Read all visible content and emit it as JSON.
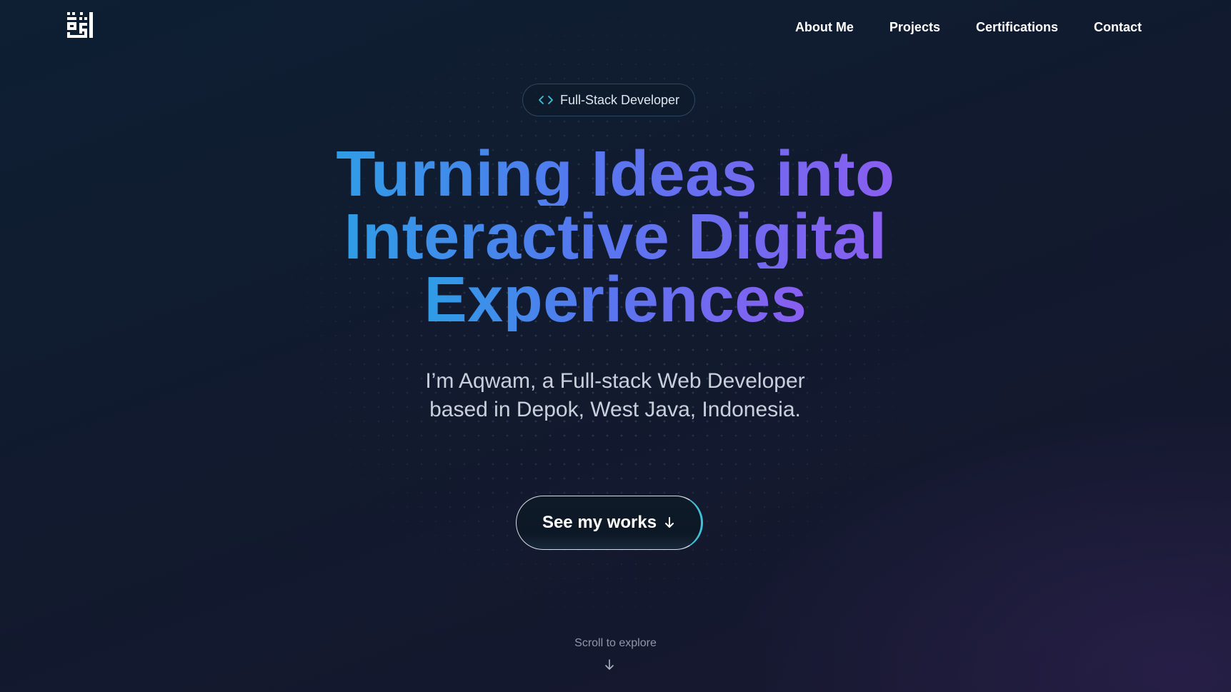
{
  "header": {
    "logo_icon": "monogram-logo-icon",
    "nav": [
      {
        "label": "About Me"
      },
      {
        "label": "Projects"
      },
      {
        "label": "Certifications"
      },
      {
        "label": "Contact"
      }
    ]
  },
  "hero": {
    "badge": {
      "icon": "code-brackets-icon",
      "label": "Full-Stack Developer"
    },
    "headline_lines": [
      "Turning Ideas into",
      "Interactive Digital",
      "Experiences"
    ],
    "subtitle": "I’m Aqwam, a Full-stack Web Developer based in Depok, West Java, Indonesia.",
    "cta": {
      "label": "See my works",
      "icon": "arrow-down-icon"
    },
    "scroll_hint": {
      "label": "Scroll to explore",
      "icon": "arrow-down-icon"
    }
  },
  "colors": {
    "gradient_start": "#2f9de6",
    "gradient_mid": "#5677ef",
    "gradient_end": "#8a5ef0",
    "accent_cyan": "#3ec3d8",
    "background": "#111a2e"
  }
}
